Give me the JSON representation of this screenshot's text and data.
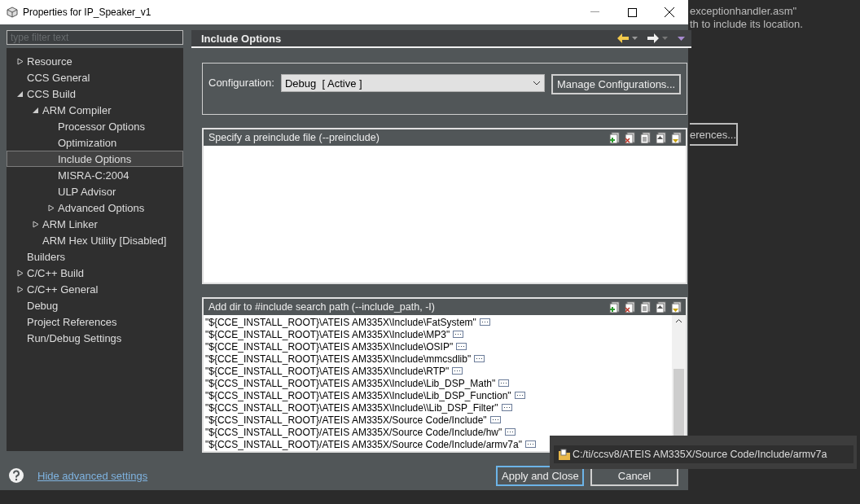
{
  "window": {
    "title": "Properties for IP_Speaker_v1"
  },
  "filter": {
    "placeholder": "type filter text"
  },
  "tree": [
    {
      "label": "Resource",
      "expanded": false,
      "selected": false
    },
    {
      "label": "CCS General",
      "selected": false
    },
    {
      "label": "CCS Build",
      "expanded": true,
      "selected": false,
      "children": [
        {
          "label": "ARM Compiler",
          "expanded": true,
          "selected": false,
          "children": [
            {
              "label": "Processor Options",
              "selected": false
            },
            {
              "label": "Optimization",
              "selected": false
            },
            {
              "label": "Include Options",
              "selected": true
            },
            {
              "label": "MISRA-C:2004",
              "selected": false
            },
            {
              "label": "ULP Advisor",
              "selected": false
            },
            {
              "label": "Advanced Options",
              "expanded": false,
              "selected": false
            }
          ]
        },
        {
          "label": "ARM Linker",
          "expanded": false,
          "selected": false
        },
        {
          "label": "ARM Hex Utility  [Disabled]",
          "selected": false
        }
      ]
    },
    {
      "label": "Builders",
      "selected": false
    },
    {
      "label": "C/C++ Build",
      "expanded": false,
      "selected": false
    },
    {
      "label": "C/C++ General",
      "expanded": false,
      "selected": false
    },
    {
      "label": "Debug",
      "selected": false
    },
    {
      "label": "Project References",
      "selected": false
    },
    {
      "label": "Run/Debug Settings",
      "selected": false
    }
  ],
  "page": {
    "title": "Include Options"
  },
  "configuration": {
    "label": "Configuration:",
    "value": "Debug  [ Active ]",
    "button": "Manage Configurations..."
  },
  "preinclude": {
    "title": "Specify a preinclude file (--preinclude)"
  },
  "include_path": {
    "title": "Add dir to #include search path (--include_path, -I)",
    "rows": [
      "\"${CCE_INSTALL_ROOT}\\ATEIS AM335X\\Include\\FatSystem\"",
      "\"${CCE_INSTALL_ROOT}\\ATEIS AM335X\\Include\\MP3\"",
      "\"${CCE_INSTALL_ROOT}\\ATEIS AM335X\\Include\\OSIP\"",
      "\"${CCE_INSTALL_ROOT}\\ATEIS AM335X\\Include\\mmcsdlib\"",
      "\"${CCE_INSTALL_ROOT}\\ATEIS AM335X\\Include\\RTP\"",
      "\"${CCS_INSTALL_ROOT}\\ATEIS AM335X\\Include\\Lib_DSP_Math\"",
      "\"${CCS_INSTALL_ROOT}\\ATEIS AM335X\\Include\\Lib_DSP_Function\"",
      "\"${CCS_INSTALL_ROOT}\\ATEIS AM335X\\Include\\\\Lib_DSP_Filter\"",
      "\"${CCS_INSTALL_ROOT}/ATEIS AM335X/Source Code/Include\"",
      "\"${CCS_INSTALL_ROOT}/ATEIS AM335X/Source Code/Include/hw\"",
      "\"${CCS_INSTALL_ROOT}/ATEIS AM335X/Source Code/Include/armv7a\""
    ]
  },
  "footer": {
    "link": "Hide advanced settings",
    "buttons": [
      "Apply and Close",
      "Cancel"
    ]
  },
  "tooltip": {
    "text": "C:/ti/ccsv8/ATEIS AM335X/Source Code/Include/armv7a"
  },
  "background": {
    "lines": [
      "exceptionhandler.asm\"",
      "th to include its location."
    ],
    "button": "erences..."
  }
}
